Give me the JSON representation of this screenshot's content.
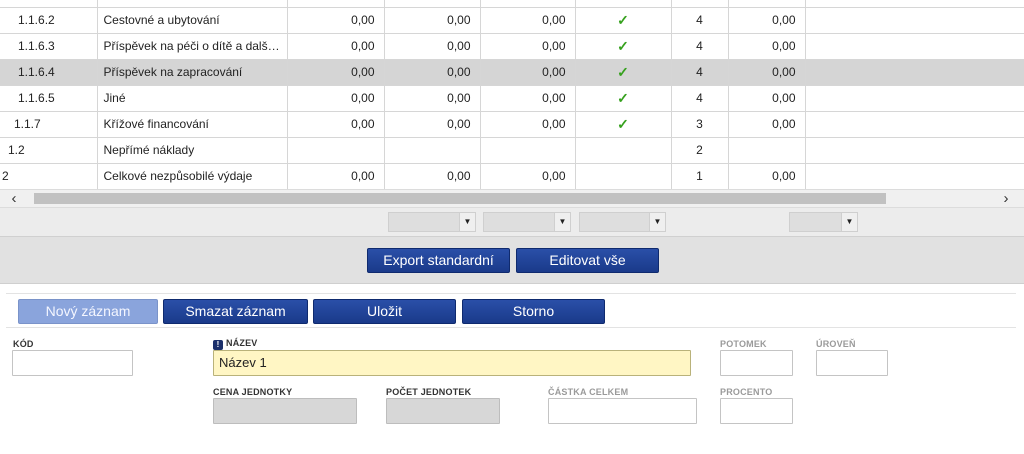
{
  "table": {
    "rows": [
      {
        "code": "",
        "name": "",
        "v1": "",
        "v2": "",
        "v3": "",
        "check": false,
        "n": "",
        "v4": ""
      },
      {
        "code": "1.1.6.2",
        "name": "Cestovné a ubytování",
        "v1": "0,00",
        "v2": "0,00",
        "v3": "0,00",
        "check": true,
        "n": "4",
        "v4": "0,00"
      },
      {
        "code": "1.1.6.3",
        "name": "Příspěvek na péči o dítě a další…",
        "v1": "0,00",
        "v2": "0,00",
        "v3": "0,00",
        "check": true,
        "n": "4",
        "v4": "0,00"
      },
      {
        "code": "1.1.6.4",
        "name": "Příspěvek na zapracování",
        "v1": "0,00",
        "v2": "0,00",
        "v3": "0,00",
        "check": true,
        "n": "4",
        "v4": "0,00"
      },
      {
        "code": "1.1.6.5",
        "name": "Jiné",
        "v1": "0,00",
        "v2": "0,00",
        "v3": "0,00",
        "check": true,
        "n": "4",
        "v4": "0,00"
      },
      {
        "code": "1.1.7",
        "name": "Křížové financování",
        "v1": "0,00",
        "v2": "0,00",
        "v3": "0,00",
        "check": true,
        "n": "3",
        "v4": "0,00"
      },
      {
        "code": "1.2",
        "name": "Nepřímé náklady",
        "v1": "",
        "v2": "",
        "v3": "",
        "check": false,
        "n": "2",
        "v4": ""
      },
      {
        "code": "2",
        "name": "Celkové nezpůsobilé výdaje",
        "v1": "0,00",
        "v2": "0,00",
        "v3": "0,00",
        "check": false,
        "n": "1",
        "v4": "0,00"
      }
    ],
    "check_glyph": "✓"
  },
  "scrollbar": {
    "left_arrow": "‹",
    "right_arrow": "›"
  },
  "filter_icon": "▼",
  "actions": {
    "export_label": "Export standardní",
    "edit_all_label": "Editovat vše"
  },
  "record_buttons": {
    "new_label": "Nový záznam",
    "delete_label": "Smazat záznam",
    "save_label": "Uložit",
    "cancel_label": "Storno"
  },
  "form": {
    "code_label": "KÓD",
    "code_value": "",
    "name_label": "NÁZEV",
    "name_value": "Název 1",
    "child_label": "POTOMEK",
    "child_value": "",
    "level_label": "ÚROVEŇ",
    "level_value": "",
    "unit_price_label": "CENA JEDNOTKY",
    "unit_price_value": "",
    "unit_count_label": "POČET JEDNOTEK",
    "unit_count_value": "",
    "total_label": "ČÁSTKA CELKEM",
    "total_value": "",
    "percent_label": "PROCENTO",
    "percent_value": ""
  },
  "colors": {
    "button_primary": "#1f41a0",
    "button_disabled": "#8aa4dc",
    "selected_row": "#d5d5d5",
    "check": "#36a11e",
    "required_field": "#fff6c4"
  }
}
